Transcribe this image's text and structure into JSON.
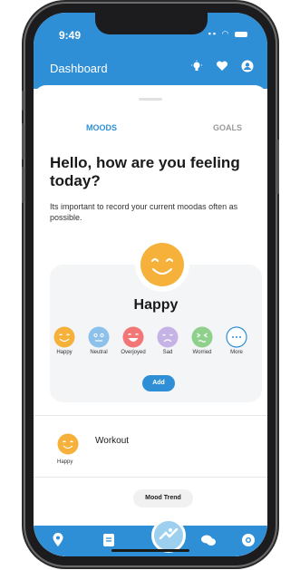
{
  "status": {
    "time": "9:49"
  },
  "header": {
    "title": "Dashboard",
    "icons": [
      "lightbulb-icon",
      "heart-icon",
      "profile-icon"
    ]
  },
  "tabs": [
    {
      "label": "MOODS",
      "active": true
    },
    {
      "label": "GOALS",
      "active": false
    }
  ],
  "greeting": {
    "title": "Hello, how are you feeling today?",
    "subtitle": "Its important to record your current moodas often as possible."
  },
  "selected_mood": "Happy",
  "moods": [
    {
      "label": "Happy",
      "color": "#f6b13b"
    },
    {
      "label": "Neutral",
      "color": "#8ec1ea"
    },
    {
      "label": "Overjoyed",
      "color": "#f27676"
    },
    {
      "label": "Sad",
      "color": "#c5b3e6"
    },
    {
      "label": "Worried",
      "color": "#8fd08c"
    },
    {
      "label": "More",
      "color": "#2f8fd6"
    }
  ],
  "add_label": "Add",
  "entries": [
    {
      "title": "Workout",
      "mood": "Happy"
    }
  ],
  "trend_label": "Mood Trend",
  "nav": [
    "location-icon",
    "journal-icon",
    "activity-icon",
    "chat-icon",
    "support-icon"
  ],
  "colors": {
    "accent": "#2f8fd6",
    "happy": "#f6b13b"
  }
}
